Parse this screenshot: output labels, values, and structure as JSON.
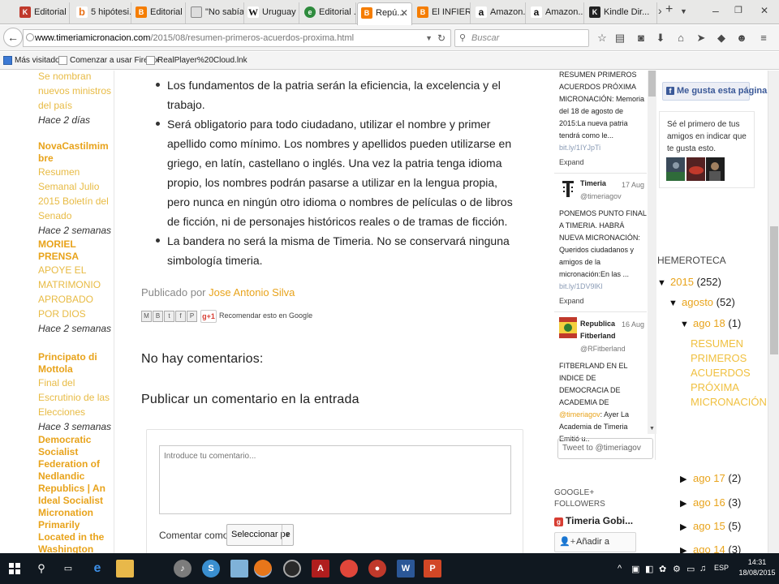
{
  "browser": {
    "tabs": [
      {
        "title": "Editorial ...",
        "icon": "red-x-icon"
      },
      {
        "title": "5 hipótesi...",
        "icon": "blogger-b-icon"
      },
      {
        "title": "Editorial ...",
        "icon": "blogger-icon"
      },
      {
        "title": "\"No sabía...",
        "icon": "page-icon"
      },
      {
        "title": "Uruguay ...",
        "icon": "wikipedia-icon"
      },
      {
        "title": "Editorial ...",
        "icon": "green-e-icon"
      },
      {
        "title": "Repú...",
        "icon": "blogger-icon",
        "active": true
      },
      {
        "title": "El INFIER...",
        "icon": "blogger-icon"
      },
      {
        "title": "Amazon....",
        "icon": "amazon-icon"
      },
      {
        "title": "Amazon....",
        "icon": "amazon-icon"
      },
      {
        "title": "Kindle Dir...",
        "icon": "kindle-icon"
      }
    ],
    "url": {
      "host": "www.timeriamicronacion.com",
      "path": "/2015/08/resumen-primeros-acuerdos-proxima.html"
    },
    "search_placeholder": "Buscar",
    "bookmarks": [
      "Más visitados",
      "Comenzar a usar Firefox",
      "RealPlayer%20Cloud.lnk"
    ]
  },
  "left_col": {
    "items": [
      {
        "blog": "",
        "post": "Se nombran nuevos ministros del país",
        "time": "Hace 2 días"
      },
      {
        "blog": "NovaCastilmimbre",
        "post": "Resumen Semanal Julio 2015 Boletín del Senado",
        "time": "Hace 2 semanas"
      },
      {
        "blog": "MORIEL PRENSA",
        "post": "APOYE EL MATRIMONIO APROBADO POR DIOS",
        "time": "Hace 2 semanas"
      },
      {
        "blog": "Principato di Mottola",
        "post": "Final del Escrutinio de las Elecciones",
        "time": "Hace 3 semanas"
      },
      {
        "blog": "Democratic Socialist Federation of Nedlandic Republics | An Ideal Socialist Micronation Primarily Located in the Washington",
        "post": "",
        "time": ""
      }
    ]
  },
  "post": {
    "bullets": [
      "Los fundamentos de la patria serán la eficiencia, la excelencia y el trabajo.",
      "Será obligatorio para todo ciudadano, utilizar el nombre y primer apellido como mínimo. Los nombres y apellidos pueden utilizarse en griego, en latín, castellano o inglés. Una vez la patria tenga idioma propio, los nombres podrán pasarse a utilizar en la lengua propia, pero nunca en ningún otro idioma o nombres de películas o de libros de ficción, ni de personajes históricos reales o de tramas de ficción.",
      "La bandera no será la misma de Timeria. No se conservará ninguna simbología timeria."
    ],
    "byline_prefix": "Publicado por",
    "author": "Jose Antonio Silva",
    "share_buttons": [
      "M",
      "B",
      "t",
      "f",
      "P"
    ],
    "gplus_label": "g+1",
    "gplus_text": "Recomendar esto en Google",
    "no_comments": "No hay comentarios:",
    "publish_title": "Publicar un comentario en la entrada",
    "comment_placeholder": "Introduce tu comentario...",
    "comment_as_label": "Comentar como:",
    "comment_as_value": "Seleccionar pe"
  },
  "twitter": {
    "tweets": [
      {
        "author": "",
        "handle": "",
        "date": "",
        "text": "RESUMEN PRIMEROS ACUERDOS PRÓXIMA MICRONACIÓN: Memoria del 18 de agosto de 2015:La nueva patria tendrá como le...",
        "link": "bit.ly/1IYJpTi",
        "expand": "Expand"
      },
      {
        "author": "Timeria",
        "handle": "@timeriagov",
        "date": "17 Aug",
        "text": "PONEMOS PUNTO FINAL A TIMERIA. HABRÁ NUEVA MICRONACIÓN: Queridos ciudadanos y amigos de la micronación:En las ...",
        "link": "bit.ly/1DV9lKl",
        "expand": "Expand"
      },
      {
        "author": "Republica Fitberland",
        "handle": "@RFitberland",
        "date": "16 Aug",
        "text_a": "FITBERLAND EN EL INDICE DE DEMOCRACIA DE ACADEMIA DE",
        "mention": "@timeriagov",
        "text_b": ": Ayer La Academia de Timeria Emitió u.."
      }
    ],
    "compose_placeholder": "Tweet to @timeriagov"
  },
  "gplus": {
    "title": "GOOGLE+ FOLLOWERS",
    "name": "Timeria Gobi...",
    "add_label": "Añadir a círculos"
  },
  "facebook": {
    "like_label": "Me gusta esta página",
    "first_text": "Sé el primero de tus amigos en indicar que te gusta esto."
  },
  "archive": {
    "title": "HEMEROTECA",
    "entries": [
      {
        "label": "2015",
        "count": "(252)",
        "expanded": true
      },
      {
        "label": "agosto",
        "count": "(52)",
        "expanded": true
      },
      {
        "label": "ago 18",
        "count": "(1)",
        "expanded": true
      },
      {
        "label": "ago 17",
        "count": "(2)",
        "expanded": false
      },
      {
        "label": "ago 16",
        "count": "(3)",
        "expanded": false
      },
      {
        "label": "ago 15",
        "count": "(5)",
        "expanded": false
      },
      {
        "label": "ago 14",
        "count": "(3)",
        "expanded": false
      }
    ],
    "current_post": "RESUMEN PRIMEROS ACUERDOS PRÓXIMA MICRONACIÓN"
  },
  "taskbar": {
    "time": "14:31",
    "date": "18/08/2015",
    "lang": "ESP"
  }
}
